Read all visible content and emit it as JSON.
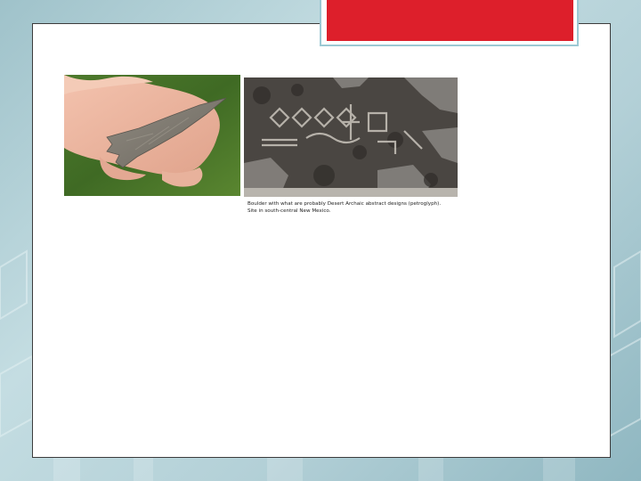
{
  "slide": {
    "header_bar_color": "#dd1f2b",
    "background_color": "#b3d0d7"
  },
  "images": {
    "arrowhead": {
      "alt": "arrowhead-in-hand-photo"
    },
    "petroglyph": {
      "alt": "boulder-petroglyph-photo"
    }
  },
  "caption": {
    "line1": "Boulder with what are probably Desert Archaic abstract designs (petroglyph).",
    "line2": "Site in south-central New Mexico."
  }
}
